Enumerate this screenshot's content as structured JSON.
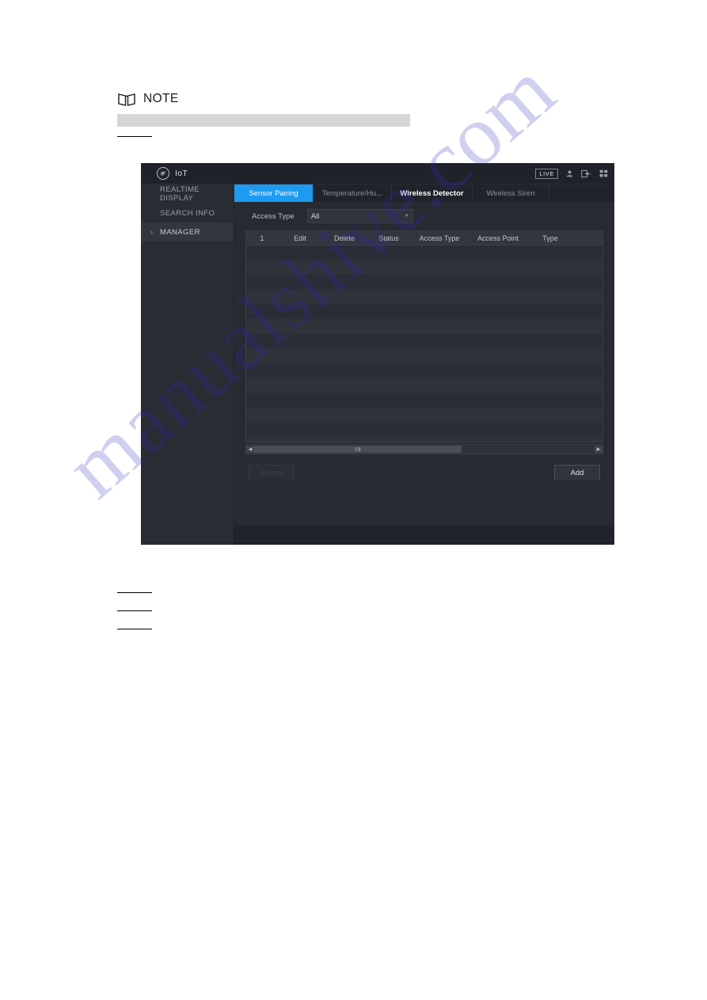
{
  "note": {
    "icon": "book-icon",
    "label": "NOTE",
    "redacted": ""
  },
  "device_ui": {
    "titlebar": {
      "logo_icon": "iot-swirl-icon",
      "title": "IoT",
      "live_badge": "LIVE",
      "icons": [
        "user-icon",
        "logout-icon",
        "apps-grid-icon"
      ]
    },
    "sidebar": {
      "items": [
        {
          "label": "REALTIME DISPLAY",
          "active": false,
          "arrow": ""
        },
        {
          "label": "SEARCH INFO",
          "active": false,
          "arrow": ""
        },
        {
          "label": "MANAGER",
          "active": true,
          "arrow": "›"
        }
      ]
    },
    "tabs": [
      {
        "label": "Sensor Pairing",
        "state": "active"
      },
      {
        "label": "Temperature/Hu...",
        "state": "normal"
      },
      {
        "label": "Wireless Detector",
        "state": "emphasis"
      },
      {
        "label": "Wireless Siren",
        "state": "normal"
      }
    ],
    "filter": {
      "label": "Access Type",
      "value": "All",
      "caret_icon": "chevron-down-icon"
    },
    "table": {
      "columns": [
        "1",
        "Edit",
        "Delete",
        "Status",
        "Access Type",
        "Access Point",
        "Type"
      ],
      "rows": []
    },
    "scrollbar": {
      "left_arrow_icon": "caret-left-icon",
      "right_arrow_icon": "caret-right-icon"
    },
    "buttons": {
      "delete": "Delete",
      "add": "Add"
    }
  },
  "watermark": {
    "text": "manualshive.com"
  },
  "colors": {
    "accent": "#1e9bf0",
    "window_bg": "#25272e",
    "panel_bg": "#282a32",
    "sidebar_bg": "#2a2c34",
    "redact": "#d6d6d6"
  }
}
